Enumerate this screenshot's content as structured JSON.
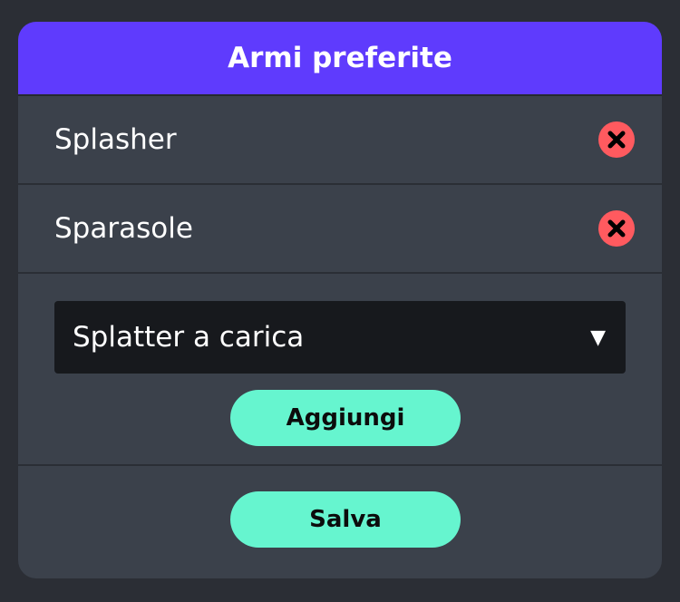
{
  "dialog": {
    "title": "Armi preferite"
  },
  "favorites": [
    {
      "label": "Splasher"
    },
    {
      "label": "Sparasole"
    }
  ],
  "add": {
    "selected_weapon": "Splatter a carica",
    "button_label": "Aggiungi"
  },
  "save": {
    "button_label": "Salva"
  },
  "colors": {
    "header": "#5f3bfd",
    "panel": "#3b414b",
    "background": "#2b2e35",
    "accent_button": "#66f5cf",
    "remove": "#ff5a5f",
    "select_bg": "#17191d"
  },
  "icons": {
    "remove": "close-icon",
    "dropdown": "caret-down-icon"
  }
}
